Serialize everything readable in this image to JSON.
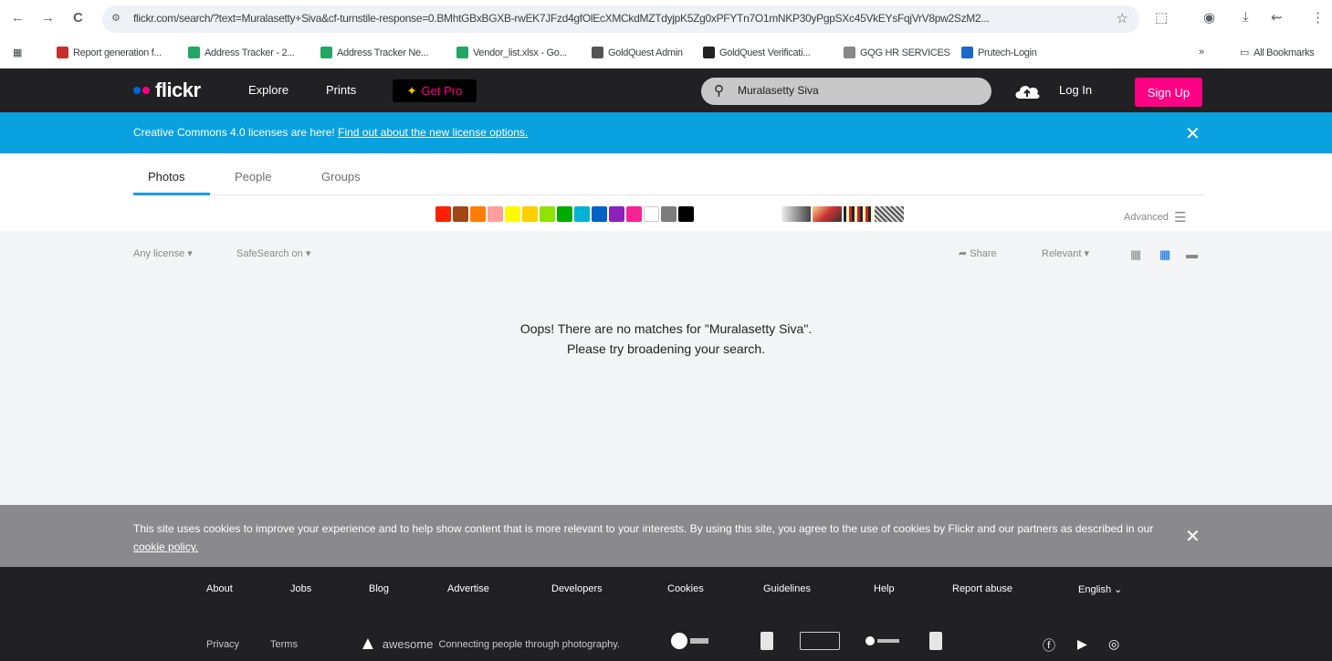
{
  "browser": {
    "back": "←",
    "forward": "→",
    "reload": "C",
    "url": "flickr.com/search/?text=Muralasetty+Siva&cf-turnstile-response=0.BMhtGBxBGXB-rwEK7JFzd4gfOlEcXMCkdMZTdyjpK5Zg0xPFYTn7O1mNKP30yPgpSXc45VkEYsFqjVrV8pw2SzM2...",
    "bookmarks": [
      {
        "label": "Report generation f...",
        "color": "#c4302b"
      },
      {
        "label": "Address Tracker - 2...",
        "color": "#23a566"
      },
      {
        "label": "Address Tracker Ne...",
        "color": "#23a566"
      },
      {
        "label": "Vendor_list.xlsx - Go...",
        "color": "#23a566"
      },
      {
        "label": "GoldQuest Admin",
        "color": "#555555"
      },
      {
        "label": "GoldQuest Verificati...",
        "color": "#222222"
      },
      {
        "label": "GQG HR SERVICES",
        "color": "#888888"
      },
      {
        "label": "Prutech-Login",
        "color": "#1b6ac9"
      }
    ],
    "more_bookmarks": "»",
    "all_bookmarks": "All Bookmarks"
  },
  "header": {
    "logo": "flickr",
    "nav": [
      "Explore",
      "Prints"
    ],
    "get_pro": "Get Pro",
    "search_value": "Muralasetty Siva",
    "login": "Log In",
    "signup": "Sign Up"
  },
  "banner": {
    "text": "Creative Commons 4.0 licenses are here!",
    "link": "Find out about the new license options.",
    "close": "✕"
  },
  "tabs": [
    "Photos",
    "People",
    "Groups"
  ],
  "colors": {
    "swatches": [
      "#ff2000",
      "#a24615",
      "#ff7c00",
      "#ff9f9c",
      "#fffa00",
      "#ffcf00",
      "#90e200",
      "#00ab00",
      "#00b2d4",
      "#0062c6",
      "#8c20ba",
      "#f52394",
      "#ffffff",
      "#7c7c7c",
      "#000000"
    ],
    "accent_blue": "#1c9be6",
    "brand_pink": "#ff0084"
  },
  "advanced": "Advanced",
  "filters": {
    "license": "Any license ▾",
    "safesearch": "SafeSearch on ▾",
    "share": "Share",
    "sort": "Relevant ▾"
  },
  "empty_state": {
    "line1": "Oops! There are no matches for \"Muralasetty Siva\".",
    "line2": "Please try broadening your search."
  },
  "cookie": {
    "text": "This site uses cookies to improve your experience and to help show content that is more relevant to your interests. By using this site, you agree to the use of cookies by Flickr and our partners as described in our",
    "link": "cookie policy.",
    "close": "✕"
  },
  "footer": {
    "links": [
      "About",
      "Jobs",
      "Blog",
      "Advertise",
      "Developers",
      "Cookies",
      "Guidelines",
      "Help",
      "Report abuse",
      "English ⌄"
    ],
    "legal": [
      "Privacy",
      "Terms"
    ],
    "awesome": "awesome",
    "tagline": "Connecting people through photography."
  }
}
